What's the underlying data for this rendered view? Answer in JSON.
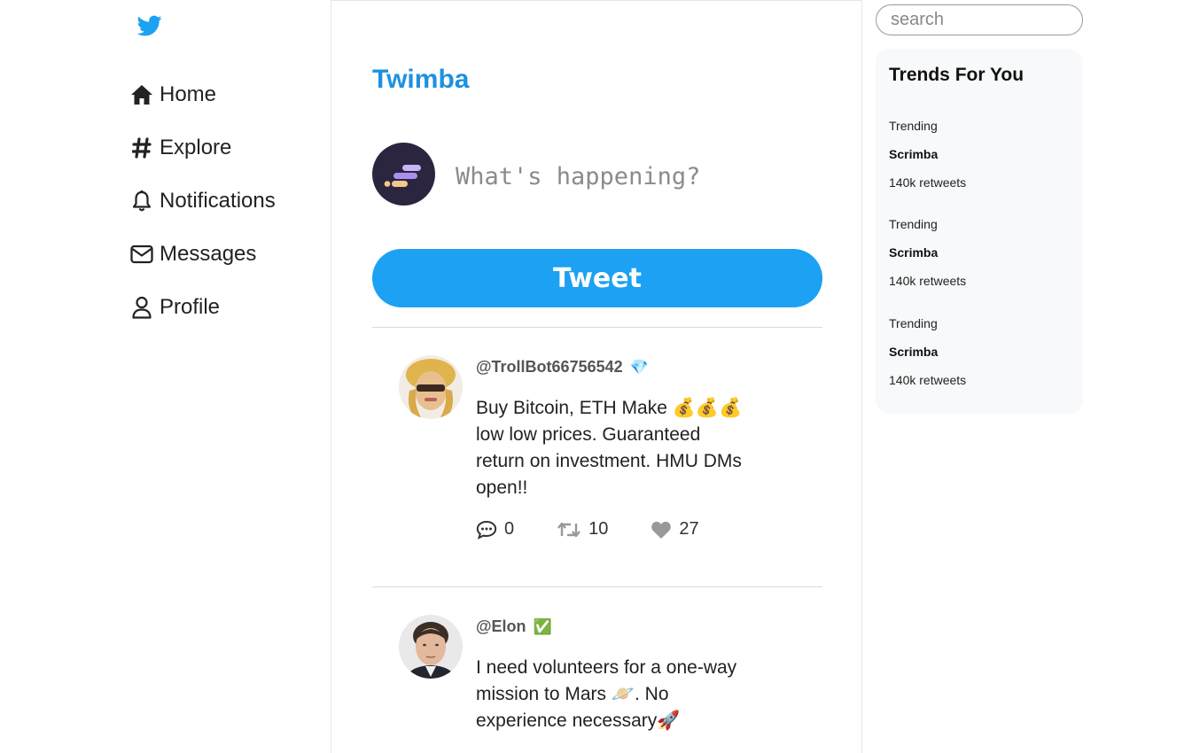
{
  "nav": {
    "logo": "twitter-bird",
    "items": [
      {
        "label": "Home",
        "icon": "home-icon"
      },
      {
        "label": "Explore",
        "icon": "hashtag-icon"
      },
      {
        "label": "Notifications",
        "icon": "bell-icon"
      },
      {
        "label": "Messages",
        "icon": "envelope-icon"
      },
      {
        "label": "Profile",
        "icon": "user-icon"
      }
    ]
  },
  "feed": {
    "title": "Twimba",
    "composer": {
      "placeholder": "What's happening?"
    },
    "tweet_button": "Tweet",
    "tweets": [
      {
        "handle": "@TrollBot66756542",
        "badge": "💎",
        "text": "Buy Bitcoin, ETH Make 💰💰💰 low low prices. Guaranteed return on investment. HMU DMs open!!",
        "replies": "0",
        "retweets": "10",
        "likes": "27"
      },
      {
        "handle": "@Elon",
        "badge": "✅",
        "text": "I need volunteers for a one-way mission to Mars 🪐. No experience necessary🚀"
      }
    ]
  },
  "sidebar": {
    "search_placeholder": "search",
    "trends_title": "Trends For You",
    "trends": [
      {
        "label": "Trending",
        "name": "Scrimba",
        "count": "140k retweets"
      },
      {
        "label": "Trending",
        "name": "Scrimba",
        "count": "140k retweets"
      },
      {
        "label": "Trending",
        "name": "Scrimba",
        "count": "140k retweets"
      }
    ]
  },
  "colors": {
    "brand": "#1da1f2",
    "title": "#1d91e0",
    "trends_bg": "#f7f9fa"
  }
}
